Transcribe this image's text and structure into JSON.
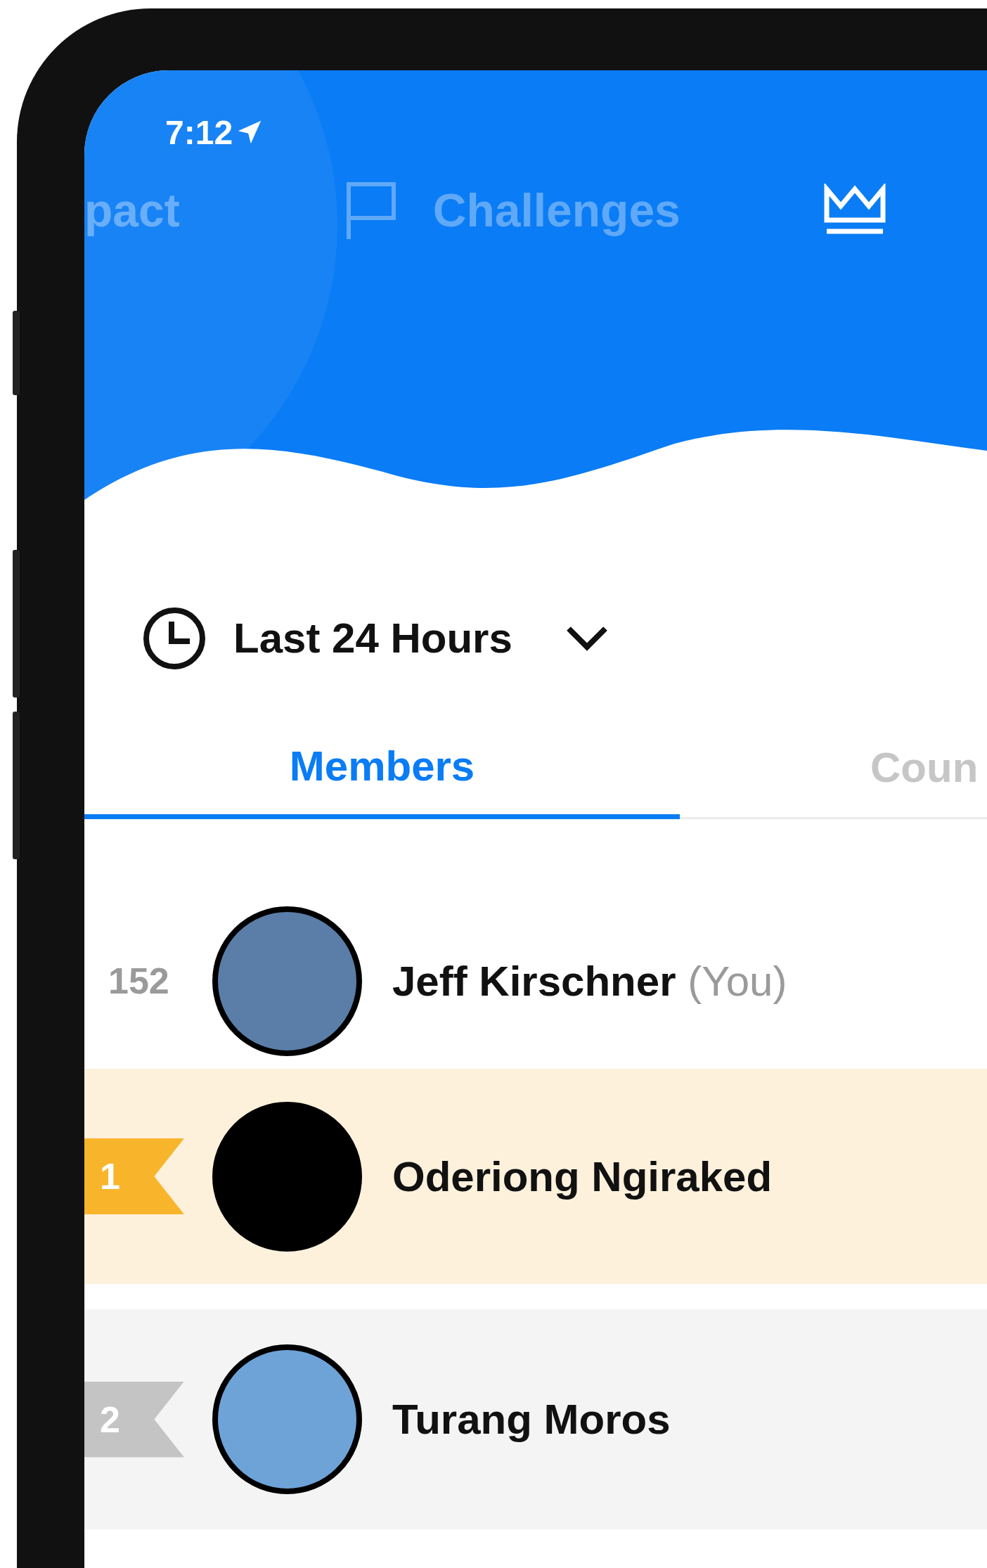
{
  "status_bar": {
    "time": "7:12"
  },
  "nav_tabs": [
    {
      "label": "pact",
      "kind": "plain",
      "selected": false
    },
    {
      "label": "Challenges",
      "kind": "flag",
      "selected": false
    },
    {
      "kind": "crown",
      "selected": true
    }
  ],
  "time_filter": {
    "label": "Last 24 Hours"
  },
  "tabs": [
    {
      "label": "Members",
      "selected": true
    },
    {
      "label": "Coun",
      "selected": false
    }
  ],
  "rows": [
    {
      "kind": "self",
      "rank": "152",
      "name": "Jeff Kirschner",
      "suffix": "(You)"
    },
    {
      "kind": "first",
      "rank": "1",
      "name": "Oderiong Ngiraked"
    },
    {
      "kind": "second",
      "rank": "2",
      "name": "Turang Moros"
    }
  ]
}
